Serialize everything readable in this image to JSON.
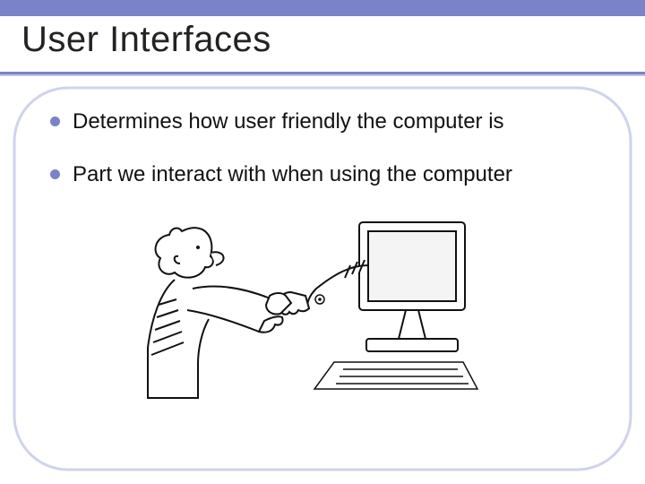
{
  "title": "User Interfaces",
  "bullets": [
    "Determines how user friendly the computer is",
    "Part we interact with when using the computer"
  ],
  "illustration_alt": "Cartoon of a man shaking hands with an arm emerging from a computer monitor"
}
